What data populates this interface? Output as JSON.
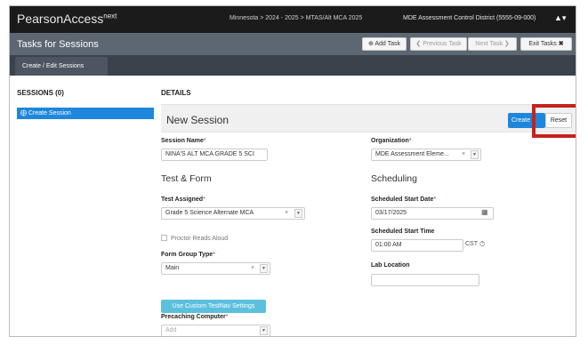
{
  "header": {
    "brand": "PearsonAccess",
    "brand_sup": "next",
    "breadcrumb": "Minnesota > 2024 - 2025 > MTAS/Alt MCA 2025",
    "district": "MDE Assessment Control District (5555-09-000)",
    "user_icon": "user-icon"
  },
  "taskbar": {
    "title": "Tasks for Sessions",
    "add_task": "Add Task",
    "previous_task": "Previous Task",
    "next_task": "Next Task",
    "exit_tasks": "Exit Tasks"
  },
  "subbar": {
    "active_tab": "Create / Edit Sessions"
  },
  "sidebar": {
    "heading": "SESSIONS (0)",
    "items": [
      {
        "label": "Create Session"
      }
    ]
  },
  "details": {
    "heading": "DETAILS",
    "session_title": "New Session",
    "create_label": "Create",
    "reset_label": "Reset"
  },
  "form": {
    "session_name_label": "Session Name",
    "session_name_value": "NINA'S ALT MCA GRADE 5 SCI",
    "organization_label": "Organization",
    "organization_value": "MDE Assessment Eleme...",
    "test_form_title": "Test & Form",
    "scheduling_title": "Scheduling",
    "test_assigned_label": "Test Assigned",
    "test_assigned_value": "Grade 5 Science Alternate MCA",
    "proctor_reads_label": "Proctor Reads Aloud",
    "form_group_label": "Form Group Type",
    "form_group_value": "Main",
    "start_date_label": "Scheduled Start Date",
    "start_date_value": "03/17/2025",
    "start_time_label": "Scheduled Start Time",
    "start_time_value": "01:00 AM",
    "timezone": "CST",
    "lab_location_label": "Lab Location",
    "lab_location_value": "",
    "custom_testnav_label": "Use Custom TestNav Settings",
    "precaching_label": "Precaching Computer",
    "precaching_placeholder": "Add",
    "required_mark": "*"
  },
  "colors": {
    "accent": "#1e87dc",
    "highlight": "#c7211c",
    "topbar": "#1b1b1b",
    "taskbar": "#5c6773",
    "info_button": "#5bc0de"
  }
}
